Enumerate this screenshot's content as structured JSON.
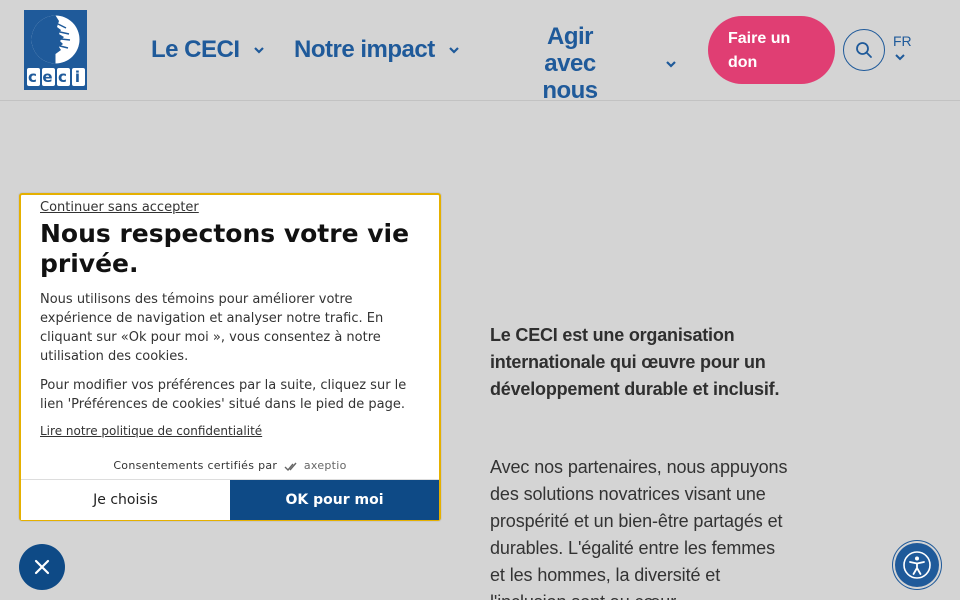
{
  "brand": {
    "logo_text": [
      "c",
      "e",
      "c",
      "i"
    ]
  },
  "nav": {
    "items": [
      {
        "label": "Le CECI"
      },
      {
        "label": "Notre impact"
      },
      {
        "label": "Agir avec nous"
      }
    ],
    "donate_label": "Faire un don",
    "language": "FR"
  },
  "hero": {
    "lead": "Le CECI est une organisation internationale qui œuvre pour un développement durable et inclusif.",
    "body": "Avec nos partenaires, nous appuyons des solutions novatrices visant une prospérité et un bien-être partagés et durables. L'égalité entre les femmes et les hommes, la diversité et l'inclusion sont au cœur"
  },
  "cookie": {
    "skip_label": "Continuer sans accepter",
    "title": "Nous respectons votre vie privée.",
    "paragraph1": "Nous utilisons des témoins pour améliorer votre expérience de navigation et analyser notre trafic. En cliquant sur «Ok pour moi », vous consentez à notre utilisation des cookies.",
    "paragraph2": "Pour modifier vos préférences par la suite, cliquez sur le lien 'Préférences de cookies' situé dans le pied de page.",
    "policy_link": "Lire notre politique de confidentialité",
    "certified_label": "Consentements certifiés par",
    "certified_brand": "axeptio",
    "choose_label": "Je choisis",
    "ok_label": "OK pour moi"
  },
  "colors": {
    "brand_blue": "#1f5a9a",
    "donate_pink": "#e03e73",
    "ok_button": "#0e4a86",
    "dialog_border": "#e5b000"
  },
  "icons": [
    "search-icon",
    "chevron-down-icon",
    "close-icon",
    "accessibility-icon"
  ]
}
